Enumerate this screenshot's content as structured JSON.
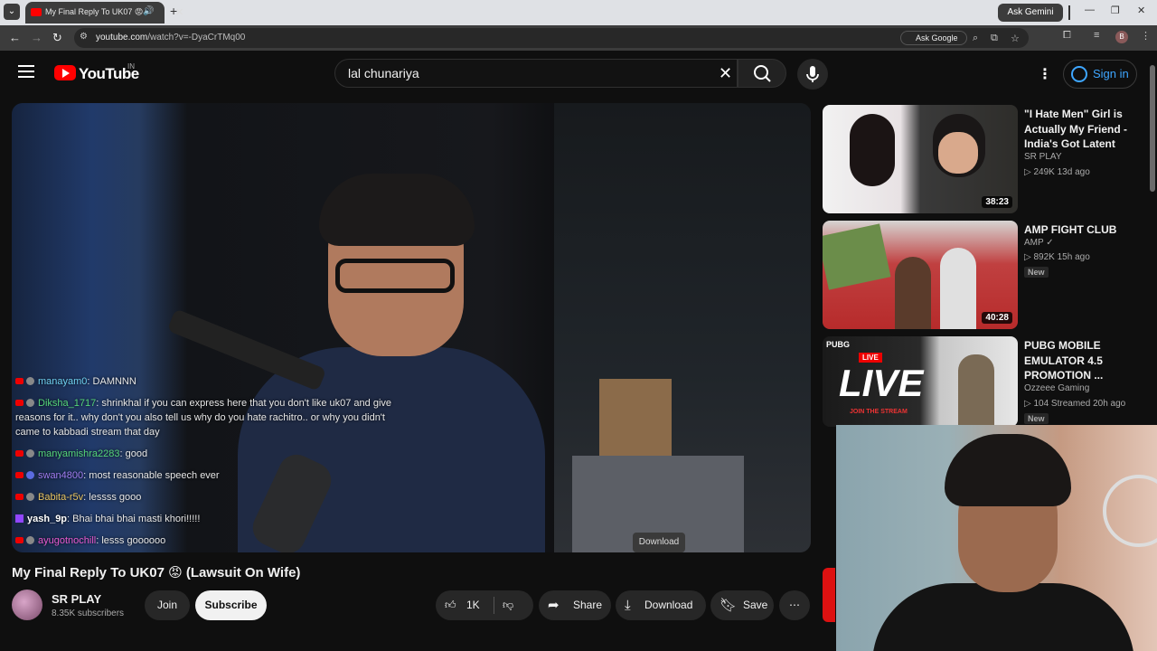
{
  "browser": {
    "tab_title": "My Final Reply To UK07 😡",
    "ask_gemini": "Ask Gemini",
    "url_host": "youtube.com",
    "url_path": "/watch?v=-DyaCrTMq00",
    "ask_google": "Ask Google",
    "profile_initial": "B"
  },
  "header": {
    "logo_text": "YouTube",
    "country": "IN",
    "search_value": "lal chunariya",
    "signin_label": "Sign in"
  },
  "video": {
    "title": "My Final Reply To UK07 😡 (Lawsuit On Wife)",
    "channel": "SR PLAY",
    "subscribers": "8.35K subscribers",
    "join_label": "Join",
    "subscribe_label": "Subscribe",
    "likes": "1K",
    "share_label": "Share",
    "download_label": "Download",
    "save_label": "Save",
    "tooltip": "Download"
  },
  "chat": [
    {
      "user": "manayam0",
      "user_color": "#6fd0f0",
      "text": "DAMNNN"
    },
    {
      "user": "Diksha_1717",
      "user_color": "#55d67a",
      "text": "shrinkhal if you can express here that you don't like uk07 and give reasons for it.. why don't you also tell us why do you hate rachitro.. or why you didn't came to kabbadi stream that day"
    },
    {
      "user": "manyamishra2283",
      "user_color": "#55d67a",
      "text": "good"
    },
    {
      "user": "swan4800",
      "user_color": "#a07cf0",
      "text": "most reasonable speech ever"
    },
    {
      "user": "Babita-r5v",
      "user_color": "#e8c460",
      "text": "lessss gooo"
    },
    {
      "user": "yash_9p",
      "user_color": "#ffffff",
      "text": "Bhai bhai bhai masti khori!!!!!"
    },
    {
      "user": "ayugotnochill",
      "user_color": "#e85ad0",
      "text": "lesss goooooo"
    }
  ],
  "recommendations": [
    {
      "title": "\"I Hate Men\" Girl is Actually My Friend - India's Got Latent",
      "channel": "SR PLAY",
      "meta": "▷ 249K  13d ago",
      "duration": "38:23",
      "badge": ""
    },
    {
      "title": "AMP FIGHT CLUB",
      "channel": "AMP ✓",
      "meta": "▷ 892K  15h ago",
      "duration": "40:28",
      "badge": "New"
    },
    {
      "title": "PUBG MOBILE EMULATOR 4.5 PROMOTION ...",
      "channel": "Ozzeee Gaming",
      "meta": "▷ 104  Streamed 20h ago",
      "duration": "",
      "badge": "New"
    }
  ],
  "thumb_text": {
    "live": "LIVE",
    "live_sub": "JOIN THE STREAM",
    "pubg": "PUBG"
  },
  "colors": {
    "accent_red": "#ff0000",
    "link_blue": "#3ea6ff",
    "bg": "#0f0f0f"
  }
}
